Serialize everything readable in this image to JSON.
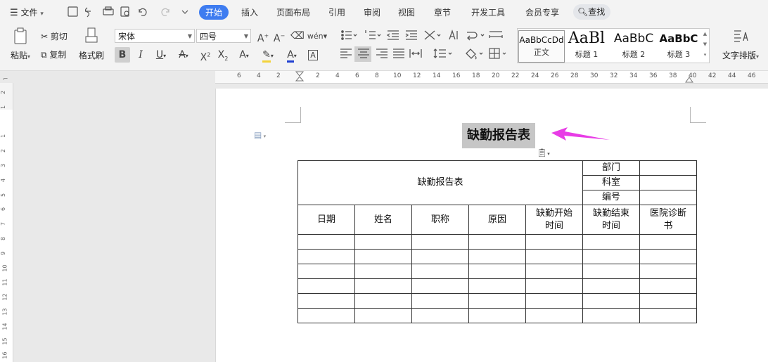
{
  "menubar": {
    "file_label": "文件",
    "tabs": [
      "开始",
      "插入",
      "页面布局",
      "引用",
      "审阅",
      "视图",
      "章节",
      "开发工具",
      "会员专享"
    ],
    "active_tab": "开始",
    "search_label": "查找"
  },
  "ribbon": {
    "paste_label": "粘贴",
    "cut_label": "剪切",
    "copy_label": "复制",
    "format_painter_label": "格式刷",
    "font_name": "宋体",
    "font_size": "四号",
    "bold": "B",
    "italic": "I",
    "underline": "U",
    "font_color_letter": "A",
    "styles": [
      {
        "preview": "AaBbCcDd",
        "label": "正文"
      },
      {
        "preview": "AaBl",
        "label": "标题 1"
      },
      {
        "preview": "AaBbC",
        "label": "标题 2"
      },
      {
        "preview": "AaBbC",
        "label": "标题 3"
      }
    ],
    "text_layout_label": "文字排版"
  },
  "ruler": {
    "h_numbers": [
      "6",
      "4",
      "2",
      "",
      "2",
      "4",
      "6",
      "8",
      "10",
      "12",
      "14",
      "16",
      "18",
      "20",
      "22",
      "24",
      "26",
      "28",
      "30",
      "32",
      "34",
      "36",
      "38",
      "40",
      "42",
      "44",
      "46"
    ],
    "v_numbers": [
      "2",
      "1",
      "",
      "1",
      "2",
      "3",
      "4",
      "5",
      "6",
      "7",
      "8",
      "9",
      "10",
      "11",
      "12",
      "13",
      "14",
      "15",
      "16"
    ]
  },
  "document": {
    "title": "缺勤报告表",
    "table": {
      "header_title": "缺勤报告表",
      "side_labels": [
        "部门",
        "科室",
        "编号"
      ],
      "columns": [
        "日期",
        "姓名",
        "职称",
        "原因",
        "缺勤开始\n时间",
        "缺勤结束\n时间",
        "医院诊断\n书"
      ],
      "empty_rows": 6
    }
  },
  "colors": {
    "accent": "#3e7cf0",
    "arrow": "#e83ce6",
    "selection": "#c6c6c6",
    "font_color_underline": "#1f3fd1",
    "highlight_underline": "#f3d33b"
  }
}
